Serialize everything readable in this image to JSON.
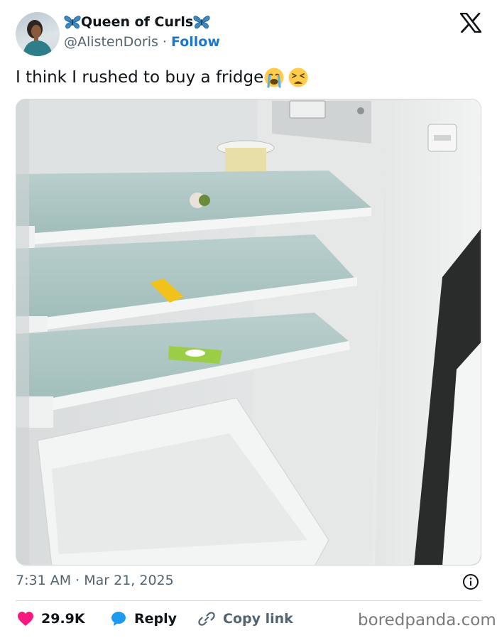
{
  "author": {
    "display_name": "Queen of Curls",
    "handle": "@AlistenDoris",
    "separator": " · ",
    "follow_label": "Follow"
  },
  "tweet": {
    "text": "I think I rushed to buy a fridge",
    "emojis": [
      "loudly-crying-face",
      "tired-face"
    ],
    "image_alt": "open nearly empty refrigerator with glass shelves",
    "timestamp": "7:31 AM · Mar 21, 2025"
  },
  "actions": {
    "likes": "29.9K",
    "reply_label": "Reply",
    "copy_label": "Copy link"
  },
  "watermark": "boredpanda.com",
  "colors": {
    "link_blue": "#1d77c9",
    "like_red": "#f91880",
    "reply_blue": "#1d9bf0",
    "muted_gray": "#536471",
    "divider": "#cfd9de"
  },
  "icons": [
    "butterfly-icon",
    "x-logo-icon",
    "info-icon",
    "heart-icon",
    "reply-bubble-icon",
    "link-icon"
  ]
}
